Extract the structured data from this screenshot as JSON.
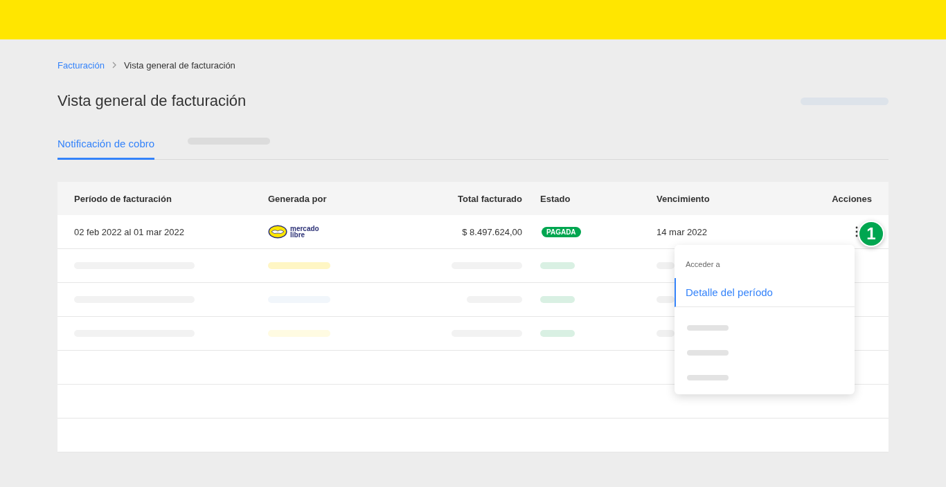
{
  "breadcrumb": {
    "items": [
      {
        "label": "Facturación",
        "kind": "link"
      },
      {
        "label": "Vista general de facturación",
        "kind": "current"
      }
    ]
  },
  "title": "Vista general de facturación",
  "tabs": [
    {
      "kind": "text",
      "label": "Notificación de cobro",
      "selected": true
    },
    {
      "kind": "skeleton",
      "selected": false
    }
  ],
  "table": {
    "columns": [
      "Período de facturación",
      "Generada por",
      "Total facturado",
      "Estado",
      "Vencimiento",
      "Acciones"
    ],
    "rows": [
      {
        "kind": "data",
        "period": "02 feb 2022 al 01 mar 2022",
        "generator_logo": "mercado libre",
        "total": "$ 8.497.624,00",
        "status": "PAGADA",
        "due": "14 mar 2022"
      },
      {
        "kind": "skeleton",
        "color": "#fff6c4"
      },
      {
        "kind": "skeleton",
        "color": "#f1f6fb"
      },
      {
        "kind": "skeleton",
        "color": "#fffbe2"
      },
      {
        "kind": "empty"
      },
      {
        "kind": "empty"
      },
      {
        "kind": "empty"
      }
    ]
  },
  "actions_menu": {
    "heading": "Acceder a",
    "items": [
      {
        "kind": "text",
        "label": "Detalle del período",
        "selected": true
      },
      {
        "kind": "skeleton",
        "selected": false
      },
      {
        "kind": "skeleton",
        "selected": false
      },
      {
        "kind": "skeleton",
        "selected": false
      }
    ]
  },
  "step_marker": "1"
}
